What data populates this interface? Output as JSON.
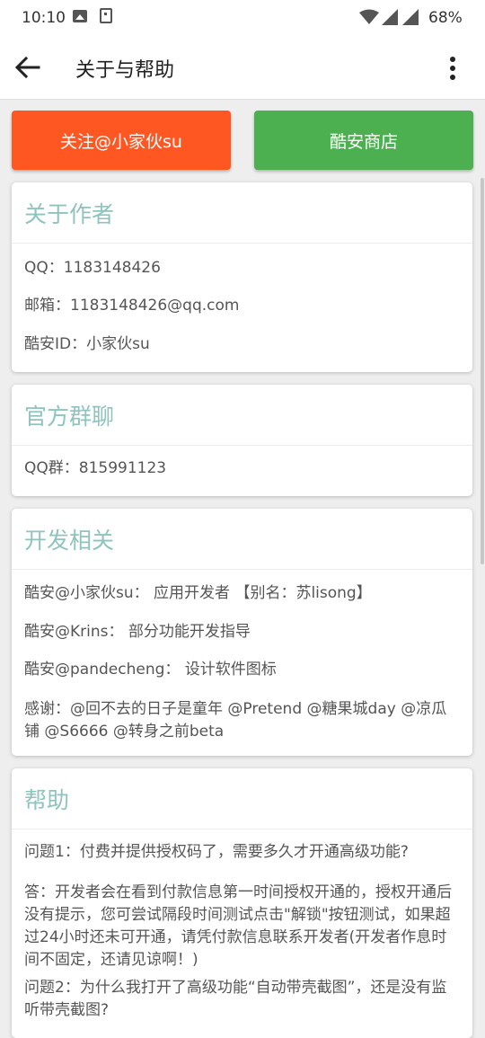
{
  "status_bar": {
    "time": "10:10",
    "battery": "68%"
  },
  "app_bar": {
    "title": "关于与帮助"
  },
  "buttons": {
    "follow": "关注@小家伙su",
    "store": "酷安商店"
  },
  "colors": {
    "follow": "#ff5722",
    "store": "#4caf50",
    "section_title": "#8fc3bd"
  },
  "about_author": {
    "title": "关于作者",
    "qq": "QQ：1183148426",
    "email": "邮箱：1183148426@qq.com",
    "coolapk_id": "酷安ID：小家伙su"
  },
  "official_group": {
    "title": "官方群聊",
    "qq_group": "QQ群：815991123"
  },
  "dev": {
    "title": "开发相关",
    "items": [
      "酷安@小家伙su： 应用开发者 【别名：苏lisong】",
      "酷安@Krins： 部分功能开发指导",
      "酷安@pandecheng： 设计软件图标",
      "感谢：@回不去的日子是童年 @Pretend @糖果城day @凉瓜铺 @S6666 @转身之前beta"
    ]
  },
  "help": {
    "title": "帮助",
    "q1": "问题1：付费并提供授权码了，需要多久才开通高级功能?",
    "a1": "答：开发者会在看到付款信息第一时间授权开通的，授权开通后没有提示，您可尝试隔段时间测试点击\"解锁\"按钮测试，如果超过24小时还未可开通，请凭付款信息联系开发者(开发者作息时间不固定，还请见谅啊！)",
    "q2": "问题2：为什么我打开了高级功能“自动带壳截图”，还是没有监听带壳截图?"
  }
}
